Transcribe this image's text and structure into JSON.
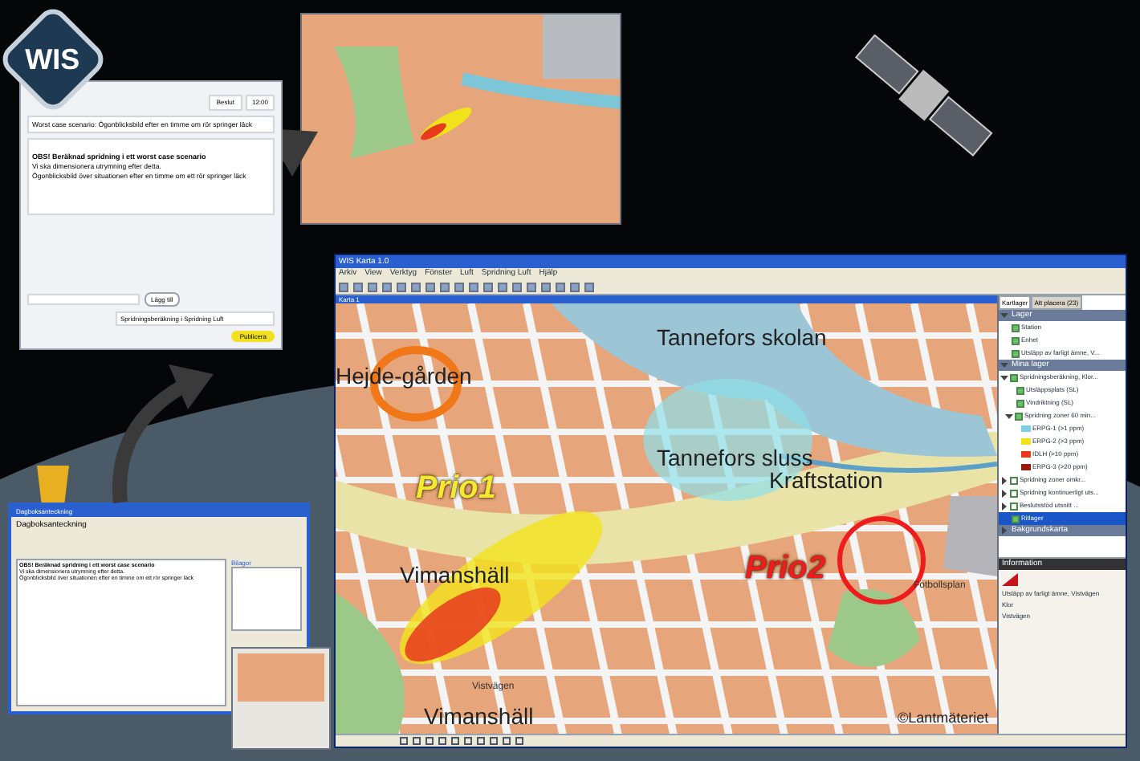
{
  "logo": {
    "text": "WIS"
  },
  "decision_dialog": {
    "tab": "Beslut",
    "time": "12:00",
    "subject": "Worst case scenario: Ögonblicksbild efter en timme om rör springer läck",
    "heading": "OBS! Beräknad spridning i ett worst case scenario",
    "lines": [
      "Vi ska dimensionera utrymning efter detta.",
      "Ögonblicksbild över situationen efter en timme om ett rör springer läck"
    ],
    "add_button": "Lägg till",
    "attachment": "Spridningsberäkning i Spridning Luft",
    "publish_button": "Publicera"
  },
  "map_window": {
    "title": "WIS Karta 1.0",
    "menus": [
      "Arkiv",
      "View",
      "Verktyg",
      "Fönster",
      "Luft",
      "Spridning Luft",
      "Hjälp"
    ],
    "map_tab": "Karta 1",
    "labels": [
      {
        "kind": "place",
        "text": "Hejde-gården"
      },
      {
        "kind": "place",
        "text": "Tannefors skolan"
      },
      {
        "kind": "place",
        "text": "Tannefors sluss"
      },
      {
        "kind": "place",
        "text": "Kraftstation"
      },
      {
        "kind": "place",
        "text": "Vimanshäll"
      },
      {
        "kind": "place",
        "text": "Vimanshäll"
      },
      {
        "kind": "street",
        "text": "Vistvägen"
      },
      {
        "kind": "street",
        "text": "Fotbollsplan"
      },
      {
        "kind": "annotation",
        "text": "Prio1",
        "color": "#f5e830"
      },
      {
        "kind": "annotation",
        "text": "Prio2",
        "color": "#ee1c1c"
      },
      {
        "kind": "credit",
        "text": "©Lantmäteriet"
      }
    ]
  },
  "layers_panel": {
    "tabs": [
      {
        "label": "Kartlager",
        "selected": true
      },
      {
        "label": "Att placera (23)",
        "selected": false
      }
    ],
    "groups": [
      {
        "title": "Lager",
        "expanded": true,
        "children": [
          {
            "label": "Station",
            "checked": true,
            "selected": false
          },
          {
            "label": "Enhet",
            "checked": true,
            "selected": false
          },
          {
            "label": "Utsläpp av farligt ämne, V...",
            "checked": true,
            "selected": false
          }
        ]
      },
      {
        "title": "Mina lager",
        "expanded": true,
        "children": [
          {
            "label": "Spridningsberäkning, Klor...",
            "checked": true,
            "selected": false,
            "expanded": true,
            "children": [
              {
                "label": "Utsläppsplats (SL)",
                "checked": true,
                "selected": false
              },
              {
                "label": "Vindriktning (SL)",
                "checked": true,
                "selected": false
              },
              {
                "label": "Spridning zoner 60 min...",
                "checked": true,
                "selected": false,
                "expanded": true,
                "children": [
                  {
                    "label": "ERPG-1 (>1 ppm)",
                    "color": "#7fd0e0",
                    "selected": false
                  },
                  {
                    "label": "ERPG-2 (>3 ppm)",
                    "color": "#f2e21c",
                    "selected": false
                  },
                  {
                    "label": "IDLH (>10 ppm)",
                    "color": "#e83a1e",
                    "selected": false
                  },
                  {
                    "label": "ERPG-3 (>20 ppm)",
                    "color": "#9a1a10",
                    "selected": false
                  }
                ]
              }
            ]
          },
          {
            "label": "Spridning zoner omkr...",
            "checked": false,
            "selected": false,
            "expanded": false
          },
          {
            "label": "Spridning kontinuerligt uts...",
            "checked": false,
            "selected": false,
            "expanded": false
          },
          {
            "label": "Beslutsstöd utsnitt ...",
            "checked": false,
            "selected": false,
            "expanded": false
          },
          {
            "label": "Ritlager",
            "checked": true,
            "selected": true
          }
        ]
      },
      {
        "title": "Bakgrundskarta",
        "expanded": false
      }
    ],
    "info": {
      "title": "Information",
      "lines": [
        "Utsläpp av farligt ämne, Vistvägen",
        "Klor",
        "Vistvägen"
      ]
    }
  },
  "diary_dialog": {
    "title": "Dagboksanteckning",
    "heading": "Dagboksanteckning",
    "text_heading": "OBS! Beräknad spridning i ett worst case scenario",
    "text_lines": [
      "Vi ska dimensionera utrymning efter detta.",
      "Ögonblicksbild över situationen efter en timme om ett rör springer läck"
    ],
    "attachments_label": "Bilagor"
  }
}
